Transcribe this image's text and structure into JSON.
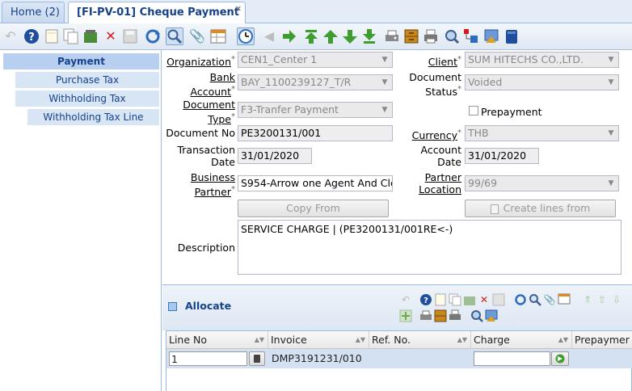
{
  "tabs": [
    {
      "label": "Home (2)"
    },
    {
      "label": "[FI-PV-01] Cheque Payment",
      "close": "✕"
    }
  ],
  "nav": {
    "items": [
      {
        "label": "Payment"
      },
      {
        "label": "Purchase Tax"
      },
      {
        "label": "Withholding Tax"
      },
      {
        "label": "Withholding Tax Line"
      }
    ]
  },
  "form": {
    "organization": {
      "label": "Organization",
      "value": "CEN1_Center 1"
    },
    "client": {
      "label": "Client",
      "value": "SUM HITECHS CO.,LTD."
    },
    "bank_account": {
      "label1": "Bank",
      "label2": "Account",
      "value": "BAY_1100239127_T/R"
    },
    "document_status": {
      "label1": "Document",
      "label2": "Status",
      "value": "Voided"
    },
    "document_type": {
      "label1": "Document",
      "label2": "Type",
      "value": "F3-Tranfer Payment"
    },
    "prepayment": {
      "label": "Prepayment",
      "checked": false
    },
    "document_no": {
      "label": "Document No",
      "value": "PE3200131/001"
    },
    "currency": {
      "label": "Currency",
      "value": "THB"
    },
    "transaction_date": {
      "label1": "Transaction",
      "label2": "Date",
      "value": "31/01/2020"
    },
    "account_date": {
      "label1": "Account",
      "label2": "Date",
      "value": "31/01/2020"
    },
    "business_partner": {
      "label1": "Business",
      "label2": "Partner",
      "value": "S954-Arrow one Agent And Cle"
    },
    "partner_location": {
      "label1": "Partner",
      "label2": "Location",
      "value": "99/69"
    },
    "copy_from_label": "Copy From",
    "create_lines_label": "Create lines from",
    "description": {
      "label": "Description",
      "value": "SERVICE CHARGE | (PE3200131/001RE<-)"
    },
    "required_mark": "*"
  },
  "allocate": {
    "title": "Allocate",
    "columns": [
      "Line No",
      "Invoice",
      "Ref. No.",
      "Charge",
      "Prepaymer"
    ],
    "rows": [
      {
        "line_no": "1",
        "invoice": "DMP3191231/010",
        "ref_no": "",
        "charge": ""
      }
    ]
  },
  "colors": {
    "accent": "#15428b",
    "border": "#99bbe8",
    "row_selected": "#d4e1f3"
  }
}
